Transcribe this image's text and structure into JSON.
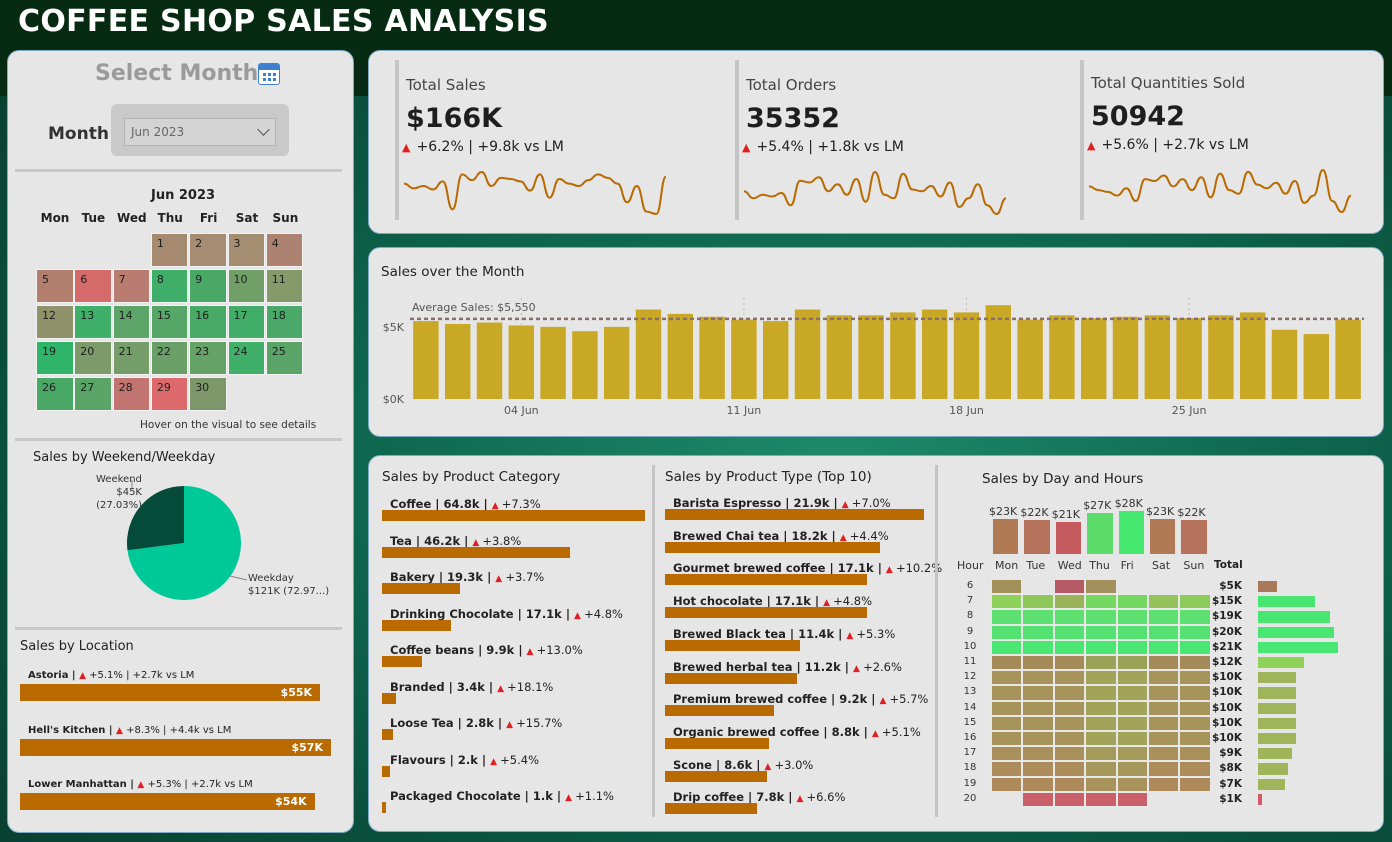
{
  "title": "COFFEE SHOP SALES ANALYSIS",
  "filter": {
    "heading": "Select Month",
    "icon": "calendar-icon",
    "label": "Month",
    "value": "Jun 2023"
  },
  "calendar": {
    "title": "Jun 2023",
    "days_of_week": [
      "Mon",
      "Tue",
      "Wed",
      "Thu",
      "Fri",
      "Sat",
      "Sun"
    ],
    "days": [
      {
        "d": "1",
        "color": "#a58a70"
      },
      {
        "d": "2",
        "color": "#a68c72"
      },
      {
        "d": "3",
        "color": "#a48d70"
      },
      {
        "d": "4",
        "color": "#ad8270"
      },
      {
        "d": "5",
        "color": "#b27e6e"
      },
      {
        "d": "6",
        "color": "#d56a6a"
      },
      {
        "d": "7",
        "color": "#b97c70"
      },
      {
        "d": "8",
        "color": "#3fae68"
      },
      {
        "d": "9",
        "color": "#4aa867"
      },
      {
        "d": "10",
        "color": "#70a068"
      },
      {
        "d": "11",
        "color": "#849a6a"
      },
      {
        "d": "12",
        "color": "#8f926b"
      },
      {
        "d": "13",
        "color": "#3faf6a"
      },
      {
        "d": "14",
        "color": "#5da468"
      },
      {
        "d": "15",
        "color": "#56a668"
      },
      {
        "d": "16",
        "color": "#49aa67"
      },
      {
        "d": "17",
        "color": "#42ad68"
      },
      {
        "d": "18",
        "color": "#4aa968"
      },
      {
        "d": "19",
        "color": "#2fb469"
      },
      {
        "d": "20",
        "color": "#7d9a6a"
      },
      {
        "d": "21",
        "color": "#759d69"
      },
      {
        "d": "22",
        "color": "#6aa068"
      },
      {
        "d": "23",
        "color": "#64a268"
      },
      {
        "d": "24",
        "color": "#3faf6a"
      },
      {
        "d": "25",
        "color": "#5ba468"
      },
      {
        "d": "26",
        "color": "#4aa867"
      },
      {
        "d": "27",
        "color": "#5aa468"
      },
      {
        "d": "28",
        "color": "#c27470"
      },
      {
        "d": "29",
        "color": "#dc6a6c"
      },
      {
        "d": "30",
        "color": "#7e976a"
      }
    ],
    "hint": "Hover on the visual to see details"
  },
  "weekend_weekday": {
    "title": "Sales by Weekend/Weekday",
    "weekend_label": "Weekend",
    "weekend_value": "$45K (27.03%)",
    "weekday_label": "Weekday",
    "weekday_value": "$121K (72.97...)",
    "weekend_pct": 27.03,
    "colors": {
      "weekend": "#064a3a",
      "weekday": "#00c999"
    }
  },
  "location": {
    "title": "Sales by Location",
    "items": [
      {
        "name": "Astoria |",
        "delta": "+5.1% | +2.7k vs LM",
        "value": "$55K",
        "sales": 55
      },
      {
        "name": "Hell's Kitchen |",
        "delta": "+8.3% | +4.4k vs LM",
        "value": "$57K",
        "sales": 57
      },
      {
        "name": "Lower Manhattan |",
        "delta": "+5.3% | +2.7k vs LM",
        "value": "$54K",
        "sales": 54
      }
    ]
  },
  "kpis": [
    {
      "label": "Total Sales",
      "value": "$166K",
      "delta": "+6.2% | +9.8k vs LM",
      "spark": [
        52,
        48,
        50,
        47,
        54,
        30,
        60,
        55,
        62,
        50,
        57,
        56,
        54,
        46,
        60,
        40,
        56,
        52,
        50,
        55,
        60,
        57,
        52,
        36,
        50,
        28,
        26,
        58
      ]
    },
    {
      "label": "Total Orders",
      "value": "35352",
      "delta": "+5.4% | +1.8k vs LM",
      "spark": [
        48,
        40,
        44,
        42,
        46,
        32,
        60,
        58,
        64,
        48,
        56,
        44,
        62,
        36,
        70,
        44,
        40,
        68,
        50,
        48,
        54,
        42,
        58,
        30,
        40,
        56,
        32,
        22,
        40
      ]
    },
    {
      "label": "Total Quantities Sold",
      "value": "50942",
      "delta": "+5.6% | +2.7k vs LM",
      "spark": [
        50,
        46,
        44,
        40,
        48,
        34,
        58,
        56,
        62,
        50,
        58,
        46,
        60,
        38,
        64,
        46,
        42,
        66,
        52,
        48,
        54,
        42,
        56,
        32,
        40,
        68,
        34,
        22,
        40
      ]
    }
  ],
  "sales_month": {
    "title": "Sales over the Month",
    "avg_label": "Average Sales: $5,550",
    "y_labels": [
      "$5K",
      "$0K"
    ],
    "x_labels": [
      "04 Jun",
      "11 Jun",
      "18 Jun",
      "25 Jun"
    ],
    "bar_color": "#c9a826"
  },
  "chart_data": {
    "type": "bar",
    "title": "Sales over the Month",
    "xlabel": "",
    "ylabel": "",
    "ylim": [
      0,
      7000
    ],
    "average": 5550,
    "categories": [
      "1",
      "2",
      "3",
      "4",
      "5",
      "6",
      "7",
      "8",
      "9",
      "10",
      "11",
      "12",
      "13",
      "14",
      "15",
      "16",
      "17",
      "18",
      "19",
      "20",
      "21",
      "22",
      "23",
      "24",
      "25",
      "26",
      "27",
      "28",
      "29",
      "30"
    ],
    "values": [
      5400,
      5200,
      5300,
      5100,
      5000,
      4700,
      5000,
      6200,
      5900,
      5700,
      5500,
      5400,
      6200,
      5800,
      5800,
      6000,
      6200,
      6000,
      6500,
      5500,
      5800,
      5600,
      5700,
      5800,
      5600,
      5800,
      6000,
      4800,
      4500,
      5500
    ]
  },
  "product_category": {
    "title": "Sales by Product Category",
    "items": [
      {
        "label": "Coffee | 64.8k |",
        "delta": "+7.3%",
        "value": 64.8
      },
      {
        "label": "Tea | 46.2k |",
        "delta": "+3.8%",
        "value": 46.2
      },
      {
        "label": "Bakery | 19.3k |",
        "delta": "+3.7%",
        "value": 19.3
      },
      {
        "label": "Drinking Chocolate | 17.1k |",
        "delta": "+4.8%",
        "value": 17.1
      },
      {
        "label": "Coffee beans | 9.9k |",
        "delta": "+13.0%",
        "value": 9.9
      },
      {
        "label": "Branded | 3.4k |",
        "delta": "+18.1%",
        "value": 3.4
      },
      {
        "label": "Loose Tea | 2.8k |",
        "delta": "+15.7%",
        "value": 2.8
      },
      {
        "label": "Flavours | 2.k |",
        "delta": "+5.4%",
        "value": 2.0
      },
      {
        "label": "Packaged Chocolate | 1.k |",
        "delta": "+1.1%",
        "value": 1.0
      }
    ]
  },
  "product_type": {
    "title": "Sales by Product Type (Top 10)",
    "items": [
      {
        "label": "Barista Espresso | 21.9k |",
        "delta": "+7.0%",
        "value": 21.9
      },
      {
        "label": "Brewed Chai tea | 18.2k |",
        "delta": "+4.4%",
        "value": 18.2
      },
      {
        "label": "Gourmet brewed coffee | 17.1k |",
        "delta": "+10.2%",
        "value": 17.1
      },
      {
        "label": "Hot chocolate | 17.1k |",
        "delta": "+4.8%",
        "value": 17.1
      },
      {
        "label": "Brewed Black tea | 11.4k |",
        "delta": "+5.3%",
        "value": 11.4
      },
      {
        "label": "Brewed herbal tea | 11.2k |",
        "delta": "+2.6%",
        "value": 11.2
      },
      {
        "label": "Premium brewed coffee | 9.2k |",
        "delta": "+5.7%",
        "value": 9.2
      },
      {
        "label": "Organic brewed coffee | 8.8k |",
        "delta": "+5.1%",
        "value": 8.8
      },
      {
        "label": "Scone | 8.6k |",
        "delta": "+3.0%",
        "value": 8.6
      },
      {
        "label": "Drip coffee | 7.8k |",
        "delta": "+6.6%",
        "value": 7.8
      }
    ]
  },
  "day_hours": {
    "title": "Sales by Day and Hours",
    "hour_header": "Hour",
    "total_header": "Total",
    "days": [
      {
        "name": "Mon",
        "label": "$23K",
        "value": 23,
        "color": "#b07a55"
      },
      {
        "name": "Tue",
        "label": "$22K",
        "value": 22,
        "color": "#b4725a"
      },
      {
        "name": "Wed",
        "label": "$21K",
        "value": 21,
        "color": "#c55a5e"
      },
      {
        "name": "Thu",
        "label": "$27K",
        "value": 27,
        "color": "#5cdc6a"
      },
      {
        "name": "Fri",
        "label": "$28K",
        "value": 28,
        "color": "#46e870"
      },
      {
        "name": "Sat",
        "label": "$23K",
        "value": 23,
        "color": "#b07a55"
      },
      {
        "name": "Sun",
        "label": "$22K",
        "value": 22,
        "color": "#b6725a"
      }
    ],
    "hours": [
      {
        "h": "6",
        "total": "$5K",
        "t": 5,
        "cells": [
          "#a2905a",
          "",
          "#b65a66",
          "#a1905c",
          "",
          "",
          ""
        ]
      },
      {
        "h": "7",
        "total": "$15K",
        "t": 15,
        "cells": [
          "#8fd25a",
          "#8fc85a",
          "#9ab358",
          "#73d760",
          "#73d760",
          "#95c25a",
          "#8ccb5a"
        ]
      },
      {
        "h": "8",
        "total": "$19K",
        "t": 19,
        "cells": [
          "#5de070",
          "#5de070",
          "#5de070",
          "#5de070",
          "#5de070",
          "#5de070",
          "#5de070"
        ]
      },
      {
        "h": "9",
        "total": "$20K",
        "t": 20,
        "cells": [
          "#55e272",
          "#55e272",
          "#55e272",
          "#55e272",
          "#55e272",
          "#55e272",
          "#55e272"
        ]
      },
      {
        "h": "10",
        "total": "$21K",
        "t": 21,
        "cells": [
          "#4ae672",
          "#4ae672",
          "#4ae672",
          "#4ae672",
          "#4ae672",
          "#4ae672",
          "#4ae672"
        ]
      },
      {
        "h": "11",
        "total": "$12K",
        "t": 12,
        "cells": [
          "#a58a5a",
          "#a58a5a",
          "#a58a5a",
          "#9aa258",
          "#9aa258",
          "#a58a5a",
          "#a58a5a"
        ]
      },
      {
        "h": "12",
        "total": "$10K",
        "t": 10,
        "cells": [
          "#a7945a",
          "#a7945a",
          "#a7945a",
          "#a2a45a",
          "#a2a45a",
          "#a7945a",
          "#a7945a"
        ]
      },
      {
        "h": "13",
        "total": "$10K",
        "t": 10,
        "cells": [
          "#a7945a",
          "#a7945a",
          "#a7945a",
          "#a2a45a",
          "#a2a45a",
          "#a7945a",
          "#a7945a"
        ]
      },
      {
        "h": "14",
        "total": "$10K",
        "t": 10,
        "cells": [
          "#a7945a",
          "#a7945a",
          "#a7945a",
          "#a2a45a",
          "#a2a45a",
          "#a7945a",
          "#a7945a"
        ]
      },
      {
        "h": "15",
        "total": "$10K",
        "t": 10,
        "cells": [
          "#a7945a",
          "#a7945a",
          "#a7945a",
          "#a2a45a",
          "#a2a45a",
          "#a7945a",
          "#a7945a"
        ]
      },
      {
        "h": "16",
        "total": "$10K",
        "t": 10,
        "cells": [
          "#a7945a",
          "#a7945a",
          "#a7945a",
          "#a2a45a",
          "#a2a45a",
          "#a7945a",
          "#a7945a"
        ]
      },
      {
        "h": "17",
        "total": "$9K",
        "t": 9,
        "cells": [
          "#aa905a",
          "#aa905a",
          "#aa905a",
          "#a49a5a",
          "#a49a5a",
          "#aa905a",
          "#aa905a"
        ]
      },
      {
        "h": "18",
        "total": "$8K",
        "t": 8,
        "cells": [
          "#ac8c5a",
          "#ac8c5a",
          "#ac8c5a",
          "#a6985a",
          "#a6985a",
          "#ac8c5a",
          "#ac8c5a"
        ]
      },
      {
        "h": "19",
        "total": "$7K",
        "t": 7,
        "cells": [
          "#ae8a5a",
          "#ae8a5a",
          "#ae8a5a",
          "#a8945a",
          "#a8945a",
          "#ae8a5a",
          "#ae8a5a"
        ]
      },
      {
        "h": "20",
        "total": "$1K",
        "t": 1,
        "cells": [
          "",
          "#c9606a",
          "#c9606a",
          "#c9606a",
          "#c9606a",
          "",
          ""
        ]
      }
    ]
  }
}
